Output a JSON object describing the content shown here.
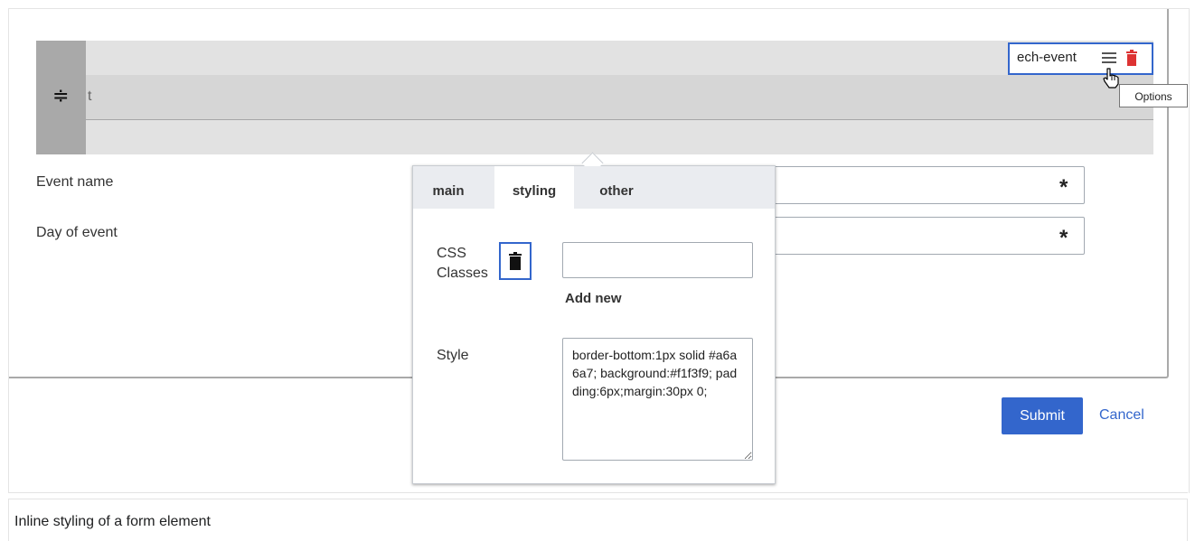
{
  "element_toolbar": {
    "element_name": "ech-event",
    "tooltip": "Options",
    "menu_icon": "menu-icon",
    "delete_icon": "trash-icon",
    "delete_color": "#dd3333"
  },
  "field_block": {
    "drag_icon": "drag-handle-icon",
    "partial_text": "t"
  },
  "form": {
    "fields": [
      {
        "label": "Event name",
        "required_mark": "*"
      },
      {
        "label": "Day of event",
        "required_mark": "*"
      }
    ],
    "submit_label": "Submit",
    "cancel_label": "Cancel"
  },
  "popup": {
    "tabs": [
      {
        "label": "main",
        "active": false
      },
      {
        "label": "styling",
        "active": true
      },
      {
        "label": "other",
        "active": false
      }
    ],
    "css_classes_label": "CSS\nClasses",
    "css_classes_value": "",
    "add_new_label": "Add new",
    "style_label": "Style",
    "style_value": "border-bottom:1px solid #a6a6a7; background:#f1f3f9; padding:6px;margin:30px 0;"
  },
  "caption": "Inline styling of a form element",
  "colors": {
    "accent": "#3366cc",
    "handle": "#a9a9a9",
    "block_bg": "#e2e2e2"
  }
}
